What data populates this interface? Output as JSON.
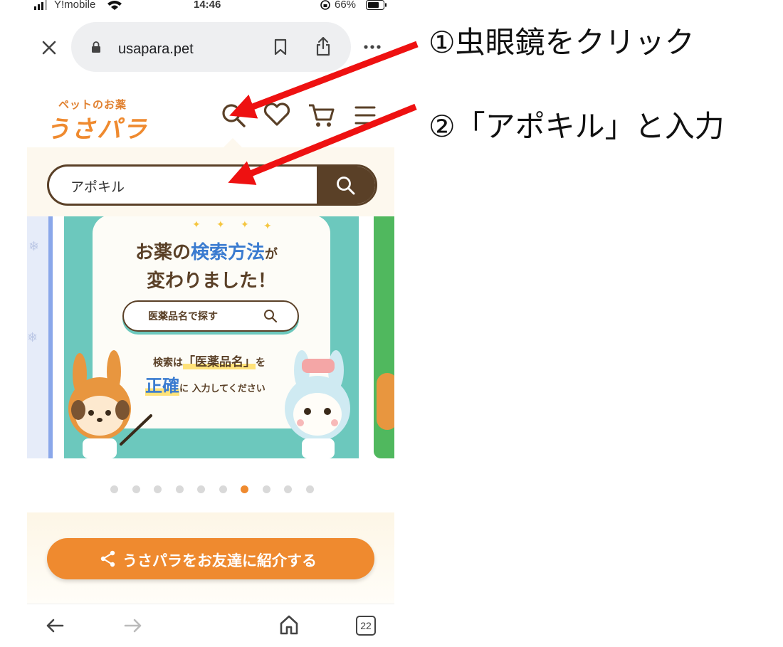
{
  "status_bar": {
    "carrier": "Y!mobile",
    "time": "14:46",
    "battery": "66%"
  },
  "browser": {
    "url": "usapara.pet",
    "tab_count": "22"
  },
  "site": {
    "logo_small": "ペットのお薬",
    "logo_big": "うさパラ"
  },
  "search": {
    "value": "アポキル"
  },
  "banner": {
    "title_pre": "お薬の",
    "title_highlight": "検索方法",
    "title_post": "が",
    "title_line2": "変わりました！",
    "search_label": "医薬品名で探す",
    "line1_pre": "検索は",
    "line1_highlight": "「医薬品名」",
    "line1_post": "を",
    "line2_highlight": "正確",
    "line2_post": "に 入力してください"
  },
  "carousel": {
    "dot_count": 10,
    "active_index": 6
  },
  "share_button": {
    "label": "うさパラをお友達に紹介する"
  },
  "annotations": {
    "step1": "①虫眼鏡をクリック",
    "step2": "②「アポキル」と入力"
  },
  "colors": {
    "brand_orange": "#ef8a2f",
    "brown": "#5a4027",
    "teal": "#6cc8bd",
    "arrow_red": "#ee1111"
  },
  "icons": {
    "wifi": "wifi-icon",
    "lock": "lock-icon",
    "bookmark": "bookmark-icon",
    "share": "share-icon",
    "more": "more-icon",
    "close": "close-icon",
    "search": "search-icon",
    "heart": "heart-icon",
    "cart": "cart-icon",
    "menu": "menu-icon",
    "back": "back-arrow-icon",
    "forward": "forward-arrow-icon",
    "home": "home-icon"
  }
}
